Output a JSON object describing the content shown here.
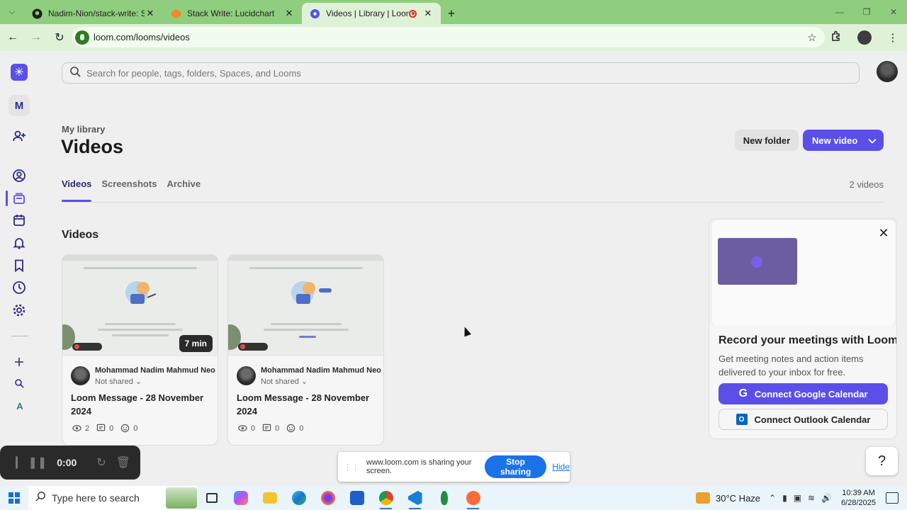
{
  "browser": {
    "tabs": [
      {
        "title": "Nadim-Nion/stack-write: Stack",
        "icon": "github-icon",
        "active": false
      },
      {
        "title": "Stack Write: Lucidchart",
        "icon": "lucidchart-icon",
        "active": false
      },
      {
        "title": "Videos | Library | Loom",
        "icon": "loom-icon",
        "active": true
      }
    ],
    "url": "loom.com/looms/videos"
  },
  "search": {
    "placeholder": "Search for people, tags, folders, Spaces, and Looms"
  },
  "sidebar": {
    "workspace_initial": "M",
    "workspace_initial_2": "A"
  },
  "header": {
    "breadcrumb": "My library",
    "title": "Videos",
    "new_folder_label": "New folder",
    "new_video_label": "New video"
  },
  "tabs": {
    "items": [
      "Videos",
      "Screenshots",
      "Archive"
    ],
    "active": "Videos",
    "count_label": "2 videos"
  },
  "section": {
    "title": "Videos"
  },
  "videos": [
    {
      "owner": "Mohammad Nadim Mahmud Neo",
      "sharing": "Not shared",
      "title": "Loom Message - 28 November 2024",
      "duration": "7 min",
      "views": "2",
      "comments": "0",
      "reactions": "0"
    },
    {
      "owner": "Mohammad Nadim Mahmud Neo",
      "sharing": "Not shared",
      "title": "Loom Message - 28 November 2024",
      "views": "0",
      "comments": "0",
      "reactions": "0"
    }
  ],
  "promo": {
    "title": "Record your meetings with Loom",
    "description": "Get meeting notes and action items delivered to your inbox for free.",
    "google_label": "Connect Google Calendar",
    "outlook_label": "Connect Outlook Calendar"
  },
  "recorder": {
    "time": "0:00"
  },
  "share_bar": {
    "message": "www.loom.com is sharing your screen.",
    "stop_label": "Stop sharing",
    "hide_label": "Hide"
  },
  "taskbar": {
    "search_placeholder": "Type here to search",
    "weather": "30°C Haze",
    "time": "10:39 AM",
    "date": "6/28/2025"
  },
  "colors": {
    "accent": "#5b4fe9",
    "browser_frame": "#8fce7e",
    "share_blue": "#1a73e8"
  }
}
